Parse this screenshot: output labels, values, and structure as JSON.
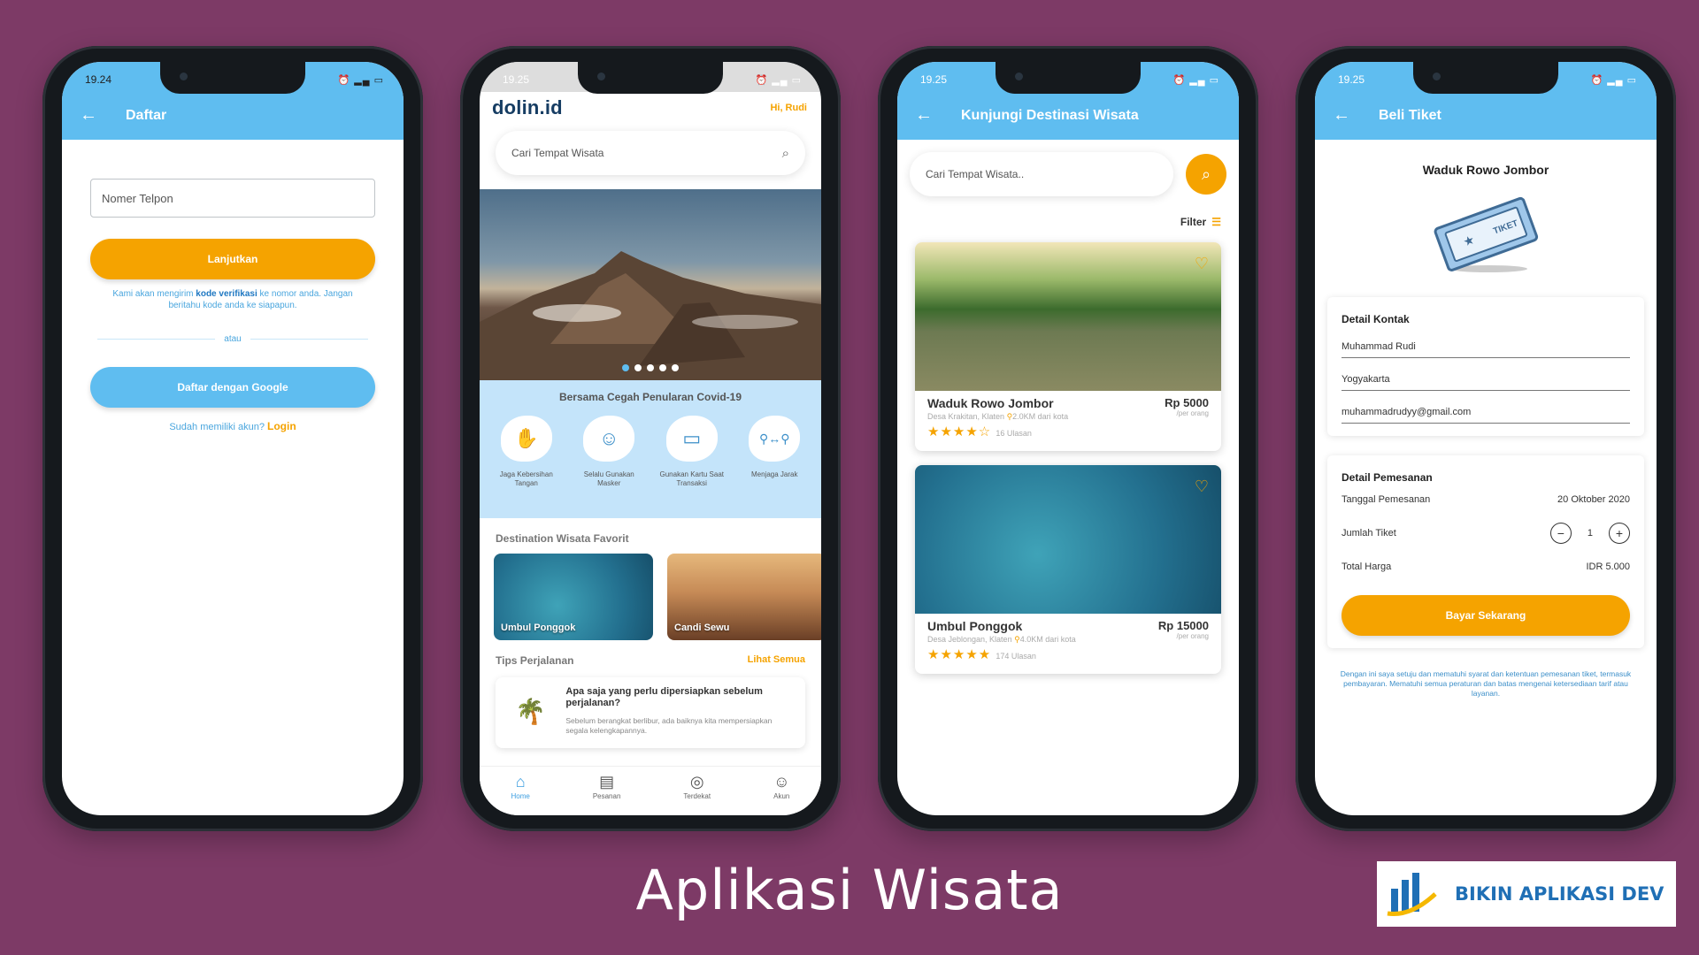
{
  "colors": {
    "background": "#7d3a66",
    "primary": "#5fbdf0",
    "accent": "#f5a300"
  },
  "phone1": {
    "time": "19.24",
    "title": "Daftar",
    "phone_placeholder": "Nomer Telpon",
    "continue_label": "Lanjutkan",
    "note_pre": "Kami akan mengirim ",
    "note_bold": "kode verifikasi",
    "note_post": " ke nomor anda. Jangan beritahu kode anda ke siapapun.",
    "or_label": "atau",
    "google_label": "Daftar dengan Google",
    "have_account": "Sudah memiliki akun? ",
    "login_label": "Login"
  },
  "phone2": {
    "time": "19.25",
    "logo": "dolin.id",
    "greeting": "Hi, Rudi",
    "search_placeholder": "Cari Tempat Wisata",
    "covid_title": "Bersama Cegah Penularan Covid-19",
    "covid_items": [
      {
        "label": "Jaga Kebersihan Tangan",
        "icon": "hand-wash-icon"
      },
      {
        "label": "Selalu Gunakan Masker",
        "icon": "mask-icon"
      },
      {
        "label": "Gunakan Kartu Saat Transaksi",
        "icon": "card-icon"
      },
      {
        "label": "Menjaga Jarak",
        "icon": "distance-icon"
      }
    ],
    "favorites_title": "Destination Wisata Favorit",
    "favorites": [
      {
        "name": "Umbul Ponggok"
      },
      {
        "name": "Candi Sewu"
      }
    ],
    "tips_title": "Tips Perjalanan",
    "tips_more": "Lihat Semua",
    "tip": {
      "title": "Apa saja yang perlu dipersiapkan sebelum perjalanan?",
      "body": "Sebelum berangkat berlibur, ada baiknya kita mempersiapkan segala kelengkapannya."
    },
    "nav": [
      {
        "label": "Home",
        "icon": "home-icon"
      },
      {
        "label": "Pesanan",
        "icon": "orders-icon"
      },
      {
        "label": "Terdekat",
        "icon": "location-icon"
      },
      {
        "label": "Akun",
        "icon": "account-icon"
      }
    ]
  },
  "phone3": {
    "time": "19.25",
    "title": "Kunjungi Destinasi Wisata",
    "search_placeholder": "Cari Tempat Wisata..",
    "filter_label": "Filter",
    "destinations": [
      {
        "name": "Waduk Rowo Jombor",
        "location": "Desa Krakitan, Klaten",
        "distance": "2.0KM dari kota",
        "reviews": "16 Ulasan",
        "price": "Rp 5000",
        "unit": "/per orang",
        "rating": 4.5
      },
      {
        "name": "Umbul Ponggok",
        "location": "Desa Jeblongan, Klaten",
        "distance": "4.0KM dari kota",
        "reviews": "174 Ulasan",
        "price": "Rp 15000",
        "unit": "/per orang",
        "rating": 5
      }
    ]
  },
  "phone4": {
    "time": "19.25",
    "title": "Beli Tiket",
    "place": "Waduk Rowo Jombor",
    "ticket_text": "TIKET",
    "contact_title": "Detail Kontak",
    "contact_name": "Muhammad Rudi",
    "contact_city": "Yogyakarta",
    "contact_email": "muhammadrudyy@gmail.com",
    "order_title": "Detail Pemesanan",
    "date_label": "Tanggal Pemesanan",
    "date_value": "20 Oktober 2020",
    "qty_label": "Jumlah Tiket",
    "qty_value": "1",
    "total_label": "Total Harga",
    "total_value": "IDR 5.000",
    "pay_label": "Bayar Sekarang",
    "terms": "Dengan ini saya setuju dan mematuhi syarat dan ketentuan pemesanan tiket, termasuk pembayaran. Mematuhi semua peraturan dan batas mengenai ketersediaan tarif atau layanan."
  },
  "page_title": "Aplikasi Wisata",
  "brand": "BIKIN APLIKASI DEV"
}
